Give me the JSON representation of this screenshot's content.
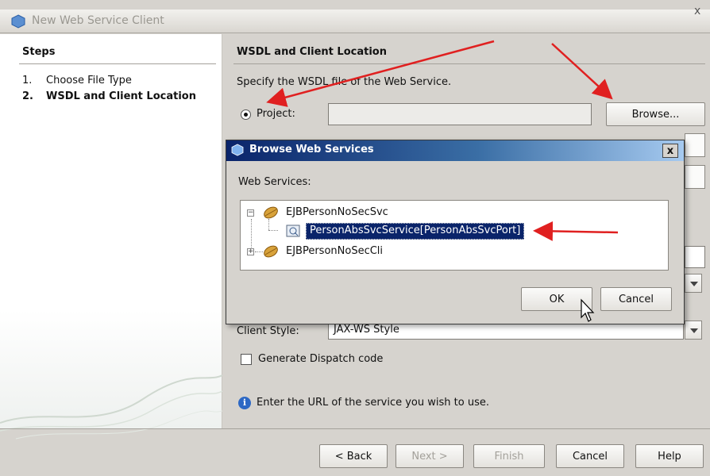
{
  "window": {
    "title": "New Web Service Client",
    "close_glyph": "x"
  },
  "steps": {
    "header": "Steps",
    "items": [
      {
        "num": "1.",
        "label": "Choose File Type"
      },
      {
        "num": "2.",
        "label": "WSDL and Client Location"
      }
    ]
  },
  "content": {
    "title": "WSDL and Client Location",
    "specify": "Specify the WSDL file of the Web Service.",
    "project_label": "Project:",
    "project_value": "",
    "browse_label": "Browse...",
    "client_style_label": "Client Style:",
    "client_style_value": "JAX-WS Style",
    "dispatch_label": "Generate Dispatch code",
    "info": "Enter the URL of the service you wish to use."
  },
  "footer": {
    "back": "< Back",
    "next": "Next >",
    "finish": "Finish",
    "cancel": "Cancel",
    "help": "Help"
  },
  "dialog": {
    "title": "Browse Web Services",
    "close_glyph": "x",
    "ws_label": "Web Services:",
    "tree": [
      {
        "label": "EJBPersonNoSecSvc",
        "expanded": true,
        "children": [
          {
            "label": "PersonAbsSvcService[PersonAbsSvcPort]",
            "selected": true
          }
        ]
      },
      {
        "label": "EJBPersonNoSecCli",
        "expanded": false
      }
    ],
    "ok": "OK",
    "cancel": "Cancel"
  },
  "colors": {
    "arrow": "#e02020",
    "selection": "#0a246a",
    "dialog_title_start": "#0a246a"
  }
}
